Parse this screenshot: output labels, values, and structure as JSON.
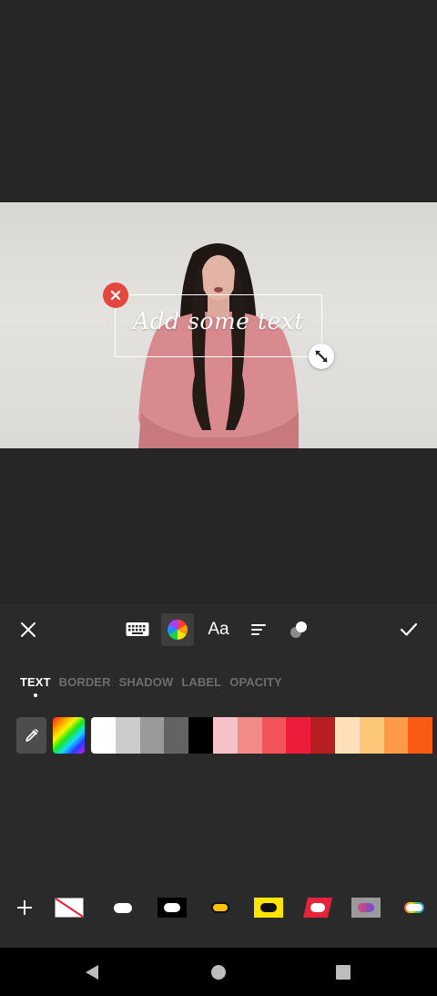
{
  "preview": {
    "overlay_text": "Add some text"
  },
  "toolbar": {
    "close_icon": "close-icon",
    "keyboard_icon": "keyboard-icon",
    "color_icon": "color-wheel-icon",
    "font_label": "Aa",
    "align_icon": "align-left-icon",
    "style_icon": "style-toggle-icon",
    "confirm_icon": "check-icon"
  },
  "tabs": [
    {
      "label": "TEXT",
      "active": true
    },
    {
      "label": "BORDER",
      "active": false
    },
    {
      "label": "SHADOW",
      "active": false
    },
    {
      "label": "LABEL",
      "active": false
    },
    {
      "label": "OPACITY",
      "active": false
    }
  ],
  "palette": {
    "picker_icon": "eyedropper-icon",
    "colors": [
      "#ffffff",
      "#cccccc",
      "#9a9a9a",
      "#636363",
      "#000000",
      "#f6c2c8",
      "#f28a87",
      "#f25259",
      "#ee1c3b",
      "#b71e22",
      "#fde0b8",
      "#fdc779",
      "#fc9a47",
      "#fb5a14"
    ]
  },
  "label_styles": {
    "add_icon": "plus-icon",
    "items": [
      "none",
      "white-pill",
      "black-box-white-pill",
      "yellow-pill",
      "yellow-box",
      "red-parallelogram",
      "gray-gradient-box",
      "rainbow-pill"
    ]
  },
  "navbar": {
    "back_icon": "back-triangle-icon",
    "home_icon": "home-circle-icon",
    "recents_icon": "recents-square-icon"
  }
}
